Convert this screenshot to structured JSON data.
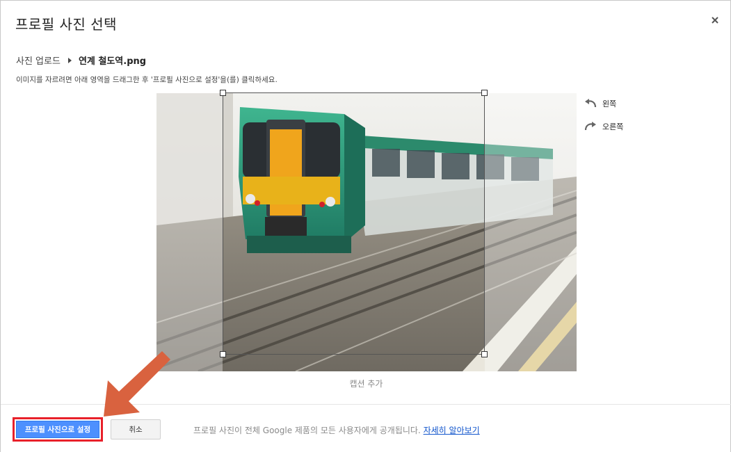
{
  "dialog": {
    "title": "프로필 사진 선택",
    "close_icon": "close-icon"
  },
  "breadcrumb": {
    "parent": "사진 업로드",
    "current": "연계 철도역.png"
  },
  "hint": "이미지를 자르려면 아래 영역을 드래그한 후 '프로필 사진으로 설정'을(를) 클릭하세요.",
  "rotate": {
    "left_label": "왼쪽",
    "right_label": "오른쪽"
  },
  "caption_placeholder": "캡션 추가",
  "footer": {
    "primary_label": "프로필 사진으로 설정",
    "cancel_label": "취소",
    "notice": "프로필 사진이 전체 Google 제품의 모든 사용자에게 공개됩니다.",
    "learn_more": "자세히 알아보기"
  },
  "colors": {
    "primary_button": "#4d90fe",
    "highlight_border": "#e8202a",
    "annotation_arrow": "#d9623f",
    "link": "#1155cc"
  }
}
